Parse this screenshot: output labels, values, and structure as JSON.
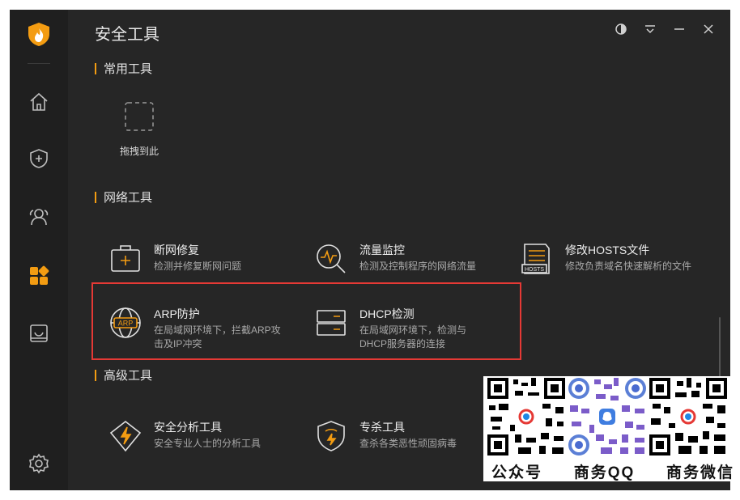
{
  "window": {
    "title": "安全工具"
  },
  "sidebar": {
    "items": [
      "home-icon",
      "shield-plus-icon",
      "users-icon",
      "apps-icon",
      "box-icon",
      "gear-icon"
    ]
  },
  "sections": {
    "common": "常用工具",
    "network": "网络工具",
    "advanced": "高级工具"
  },
  "drop_zone": {
    "label": "拖拽到此"
  },
  "tools": {
    "net_repair": {
      "name": "断网修复",
      "desc": "检测并修复断网问题"
    },
    "traffic": {
      "name": "流量监控",
      "desc": "检测及控制程序的网络流量"
    },
    "hosts": {
      "name": "修改HOSTS文件",
      "desc": "修改负责域名快速解析的文件",
      "icon_text": "HOSTS"
    },
    "arp": {
      "name": "ARP防护",
      "desc": "在局域网环境下，拦截ARP攻击及IP冲突",
      "icon_text": "ARP"
    },
    "dhcp": {
      "name": "DHCP检测",
      "desc": "在局域网环境下，检测与DHCP服务器的连接"
    },
    "analysis": {
      "name": "安全分析工具",
      "desc": "安全专业人士的分析工具"
    },
    "kill": {
      "name": "专杀工具",
      "desc": "查杀各类恶性顽固病毒"
    }
  },
  "qr": {
    "labels": [
      "公众号",
      "商务QQ",
      "商务微信"
    ]
  },
  "colors": {
    "accent": "#f39c12",
    "highlight": "#e53935",
    "bg": "#262626",
    "sidebar": "#1f1f1f"
  }
}
